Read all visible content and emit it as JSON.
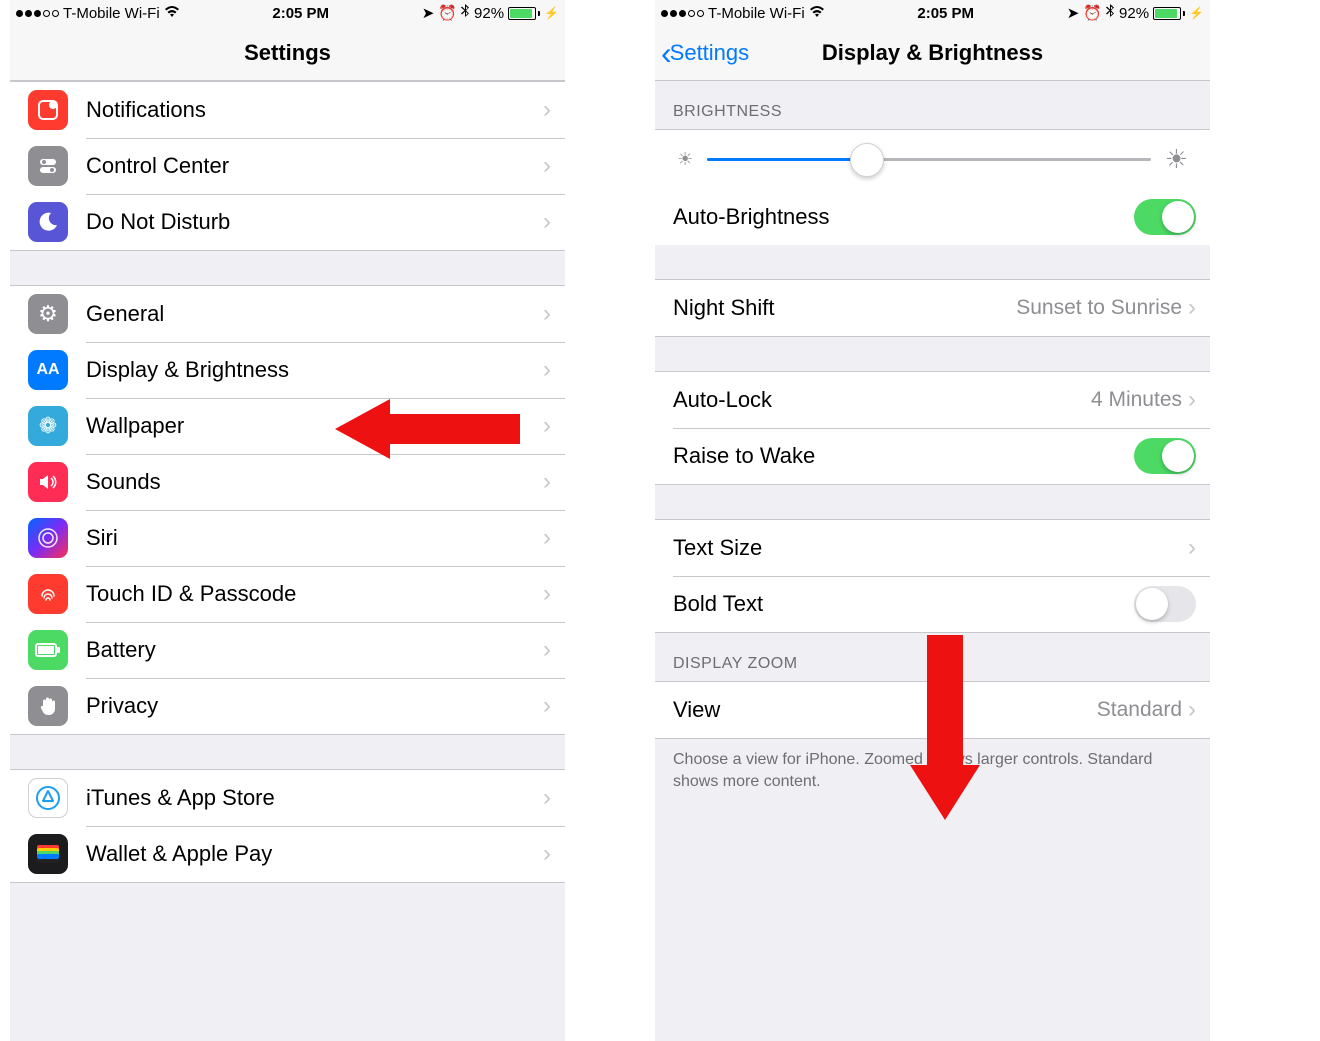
{
  "status": {
    "carrier": "T-Mobile Wi-Fi",
    "time": "2:05 PM",
    "battery_pct": "92%",
    "battery_fill_pct": 92
  },
  "left": {
    "title": "Settings",
    "group1": [
      {
        "label": "Notifications",
        "icon_bg": "bg-red",
        "icon": "◻"
      },
      {
        "label": "Control Center",
        "icon_bg": "bg-gray",
        "icon": "⦿"
      },
      {
        "label": "Do Not Disturb",
        "icon_bg": "bg-purple",
        "icon": "☾"
      }
    ],
    "group2": [
      {
        "label": "General",
        "icon_bg": "bg-gray",
        "icon": "⚙"
      },
      {
        "label": "Display & Brightness",
        "icon_bg": "bg-blue",
        "icon": "ᴬA"
      },
      {
        "label": "Wallpaper",
        "icon_bg": "bg-cyan",
        "icon": "✿"
      },
      {
        "label": "Sounds",
        "icon_bg": "bg-pink",
        "icon": "🔊"
      },
      {
        "label": "Siri",
        "icon_bg": "bg-siri",
        "icon": "◉"
      },
      {
        "label": "Touch ID & Passcode",
        "icon_bg": "bg-red",
        "icon": "◉"
      },
      {
        "label": "Battery",
        "icon_bg": "bg-green",
        "icon": "▮"
      },
      {
        "label": "Privacy",
        "icon_bg": "bg-gray",
        "icon": "✋"
      }
    ],
    "group3": [
      {
        "label": "iTunes & App Store",
        "icon_bg": "bg-white",
        "icon": "Ⓐ"
      },
      {
        "label": "Wallet & Apple Pay",
        "icon_bg": "bg-black",
        "icon": "▭"
      }
    ]
  },
  "right": {
    "back_label": "Settings",
    "title": "Display & Brightness",
    "section_brightness": "Brightness",
    "brightness_pct": 36,
    "auto_brightness": {
      "label": "Auto-Brightness",
      "on": true
    },
    "night_shift": {
      "label": "Night Shift",
      "value": "Sunset to Sunrise"
    },
    "auto_lock": {
      "label": "Auto-Lock",
      "value": "4 Minutes"
    },
    "raise_to_wake": {
      "label": "Raise to Wake",
      "on": true
    },
    "text_size": {
      "label": "Text Size"
    },
    "bold_text": {
      "label": "Bold Text",
      "on": false
    },
    "section_zoom": "Display Zoom",
    "view": {
      "label": "View",
      "value": "Standard"
    },
    "footer": "Choose a view for iPhone. Zoomed shows larger controls. Standard shows more content."
  }
}
